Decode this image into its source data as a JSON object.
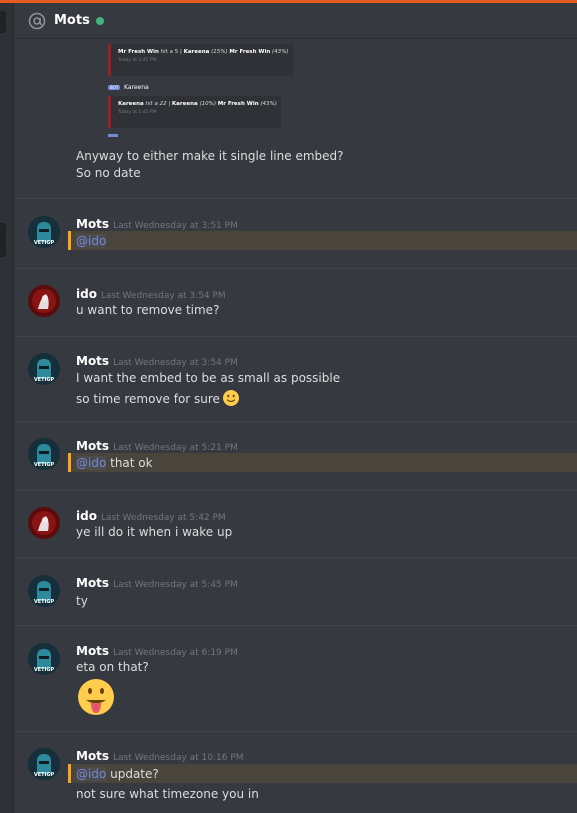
{
  "header": {
    "channel_name": "Mots",
    "status": "online",
    "accent_color": "#e85b1e"
  },
  "embed_preview": {
    "line1": {
      "a": "Mr Fresh Win",
      "b": " hit a 5 | ",
      "c": "Kareena",
      "d": " (15%) ",
      "e": "Mr Fresh Win",
      "f": " (43%)"
    },
    "sub1": "Today at 1:45 PM",
    "bot_tag": "BOT",
    "bot_name": "Kareena",
    "line2": {
      "a": "Kareena",
      "b": " hit a 22 | ",
      "c": "Kareena",
      "d": " (10%) ",
      "e": "Mr Fresh Win",
      "f": " (43%)"
    },
    "sub2": "Today at 1:45 PM"
  },
  "intro_lines": [
    "Anyway to either make it single line embed?",
    "So no date"
  ],
  "messages": [
    {
      "author": "Mots",
      "timestamp": "Last Wednesday at 3:51 PM",
      "mention": "@ido",
      "text": ""
    },
    {
      "author": "ido",
      "timestamp": "Last Wednesday at 3:54 PM",
      "text": "u want to remove time?"
    },
    {
      "author": "Mots",
      "timestamp": "Last Wednesday at 3:54 PM",
      "text": "I want the embed to be as small as possible",
      "text2": "so time remove for sure"
    },
    {
      "author": "Mots",
      "timestamp": "Last Wednesday at 5:21 PM",
      "mention": "@ido",
      "text": " that ok"
    },
    {
      "author": "ido",
      "timestamp": "Last Wednesday at 5:42 PM",
      "text": "ye ill do it when i wake up"
    },
    {
      "author": "Mots",
      "timestamp": "Last Wednesday at 5:45 PM",
      "text": "ty"
    },
    {
      "author": "Mots",
      "timestamp": "Last Wednesday at 6:19 PM",
      "text": "eta on that?"
    },
    {
      "author": "Mots",
      "timestamp": "Last Wednesday at 10:16 PM",
      "mention": "@ido",
      "text": " update?",
      "text2": "not sure what timezone you in"
    }
  ],
  "avatar_mots_label": "VETIGP",
  "colors": {
    "background": "#36393f",
    "mention_highlight": "#49443c",
    "mention_bar": "#faa61a",
    "mention_text": "#7289da",
    "online": "#43b581"
  }
}
